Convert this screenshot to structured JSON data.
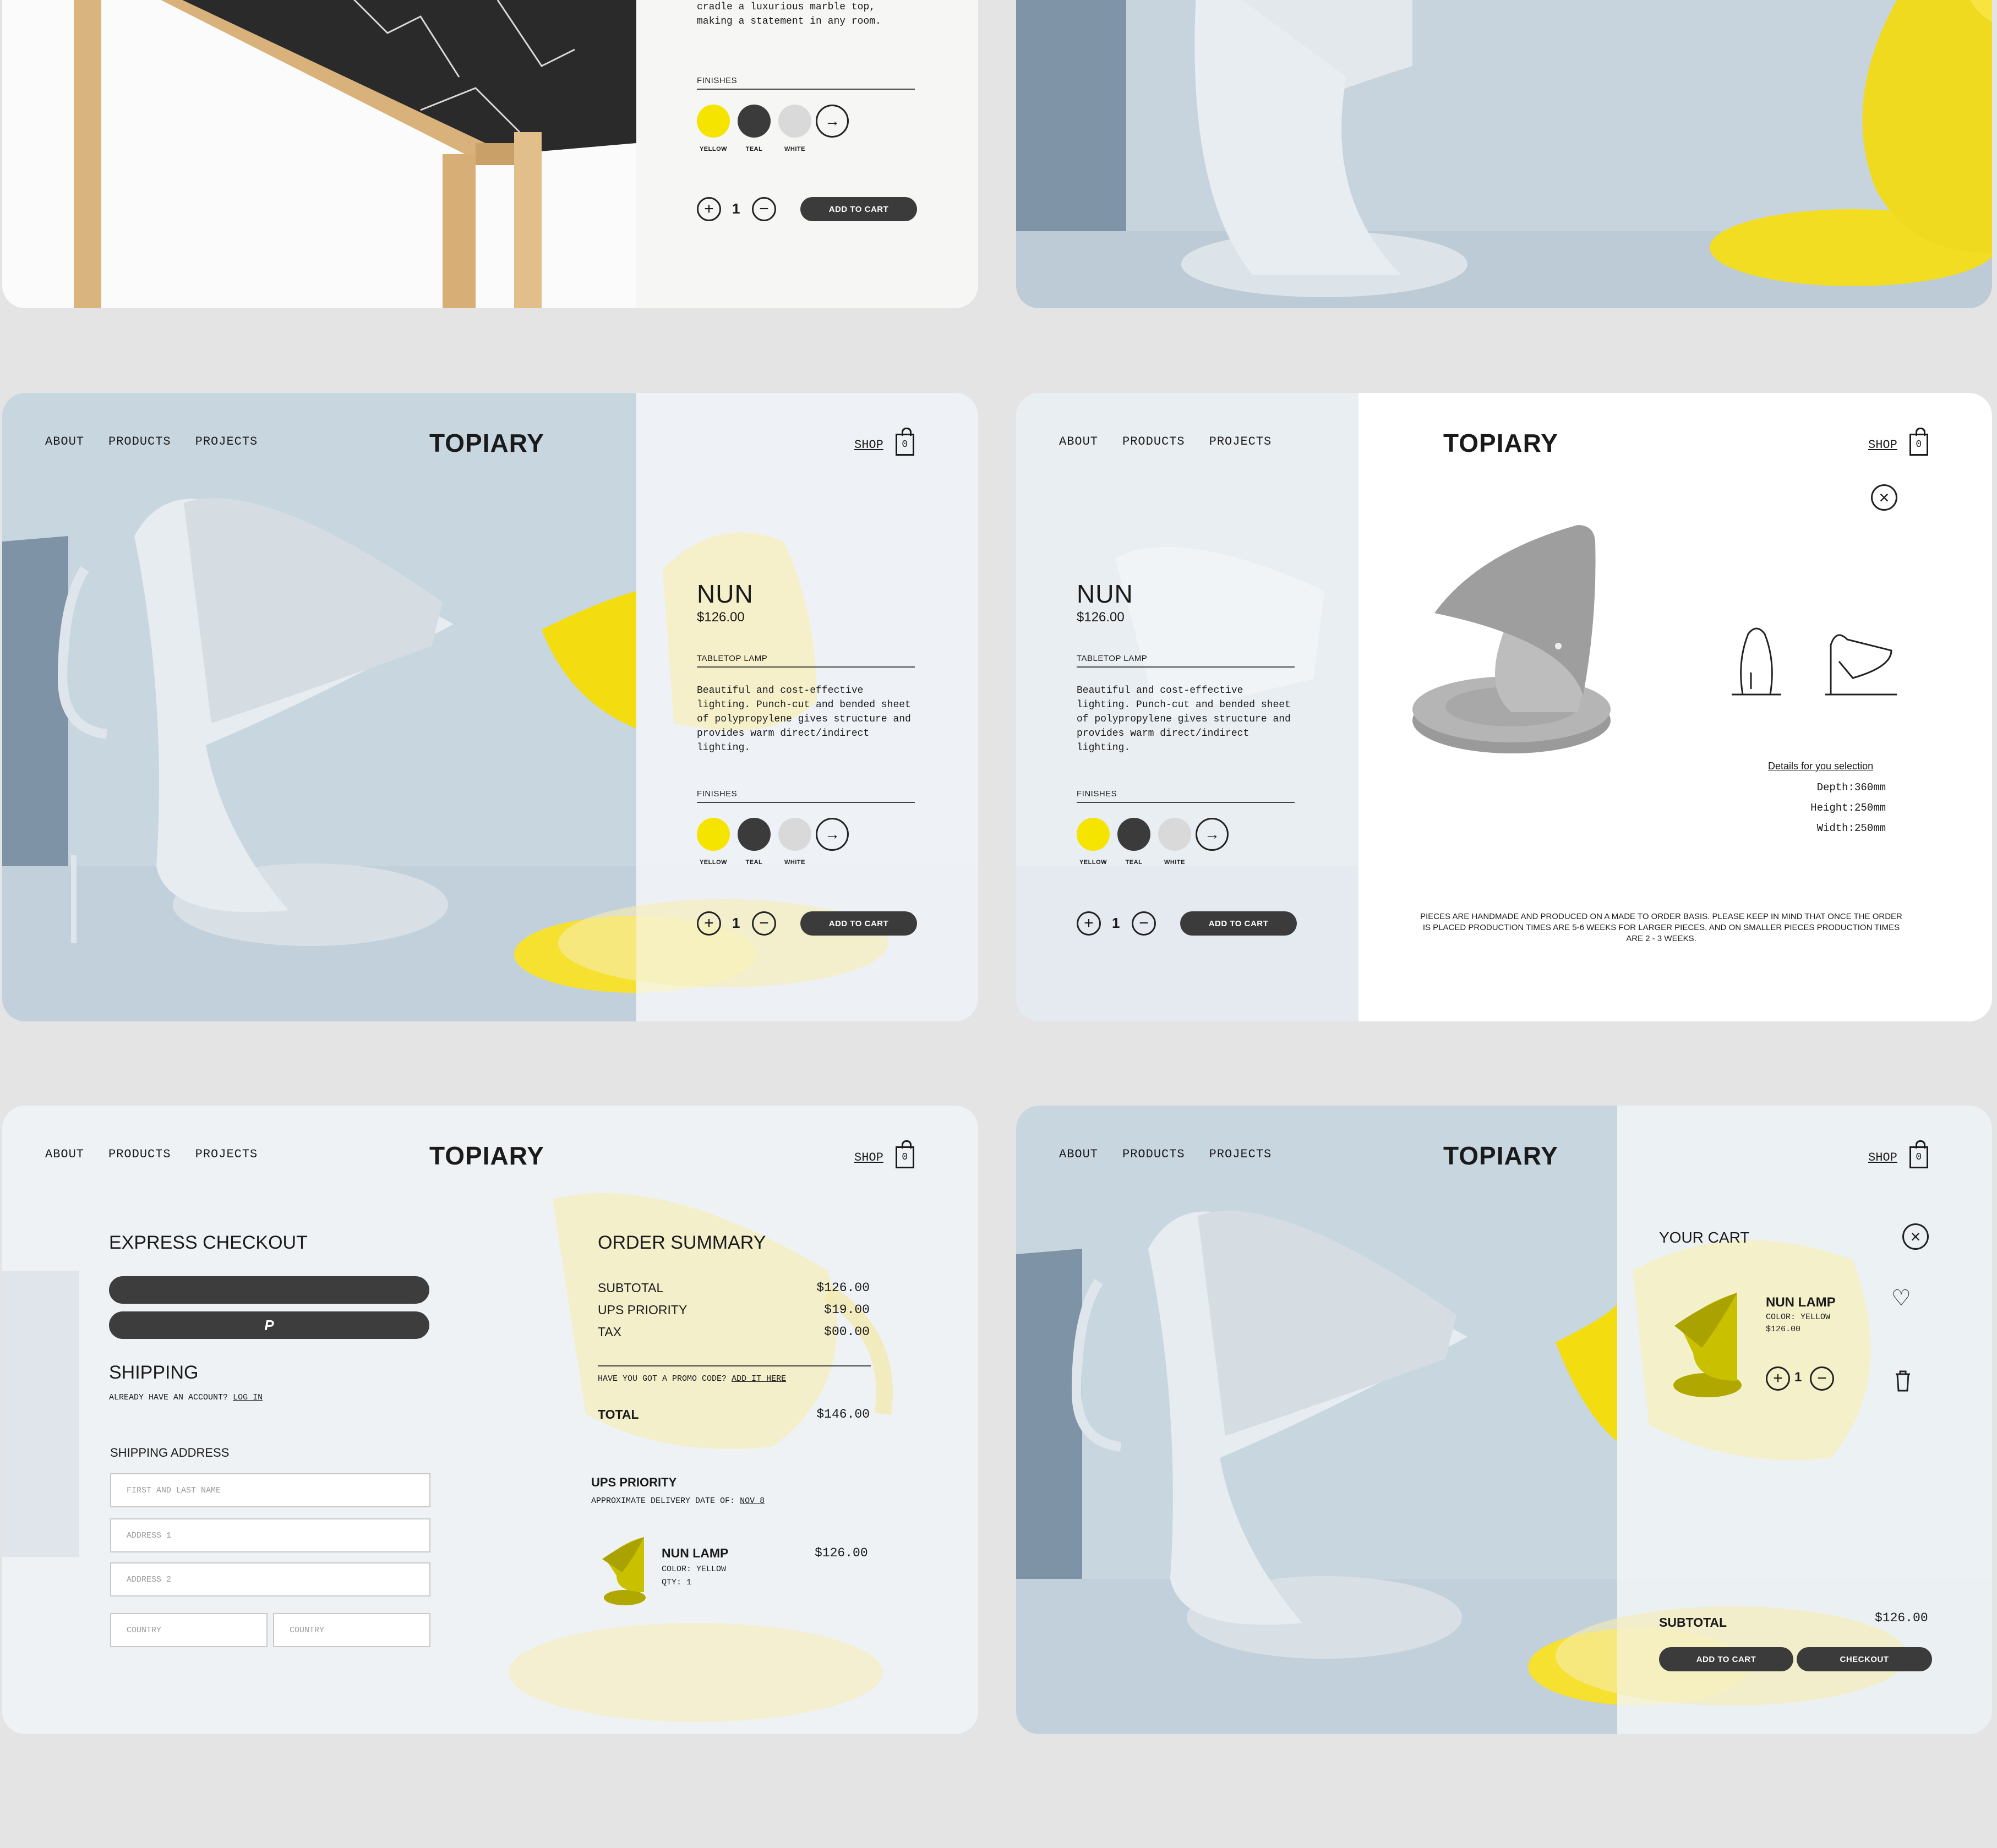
{
  "nav": {
    "about": "ABOUT",
    "products": "PRODUCTS",
    "projects": "PROJECTS",
    "logo": "TOPIARY",
    "shop": "SHOP",
    "cart_count": "0"
  },
  "table_card": {
    "desc_tail": "cradle a luxurious marble top,\nmaking a statement in any room.",
    "finishes_label": "FINISHES",
    "finishes": [
      "YELLOW",
      "TEAL",
      "WHITE"
    ],
    "qty": "1",
    "add_to_cart": "ADD TO CART"
  },
  "product": {
    "name": "NUN",
    "price": "$126.00",
    "category": "TABLETOP LAMP",
    "description": "Beautiful and cost-effective lighting. Punch-cut and bended sheet of polypropylene gives structure and provides warm direct/indirect lighting.",
    "finishes_label": "FINISHES",
    "finishes": [
      "YELLOW",
      "TEAL",
      "WHITE"
    ],
    "finish_colors": [
      "#f5e400",
      "#3b3b3b",
      "#d9d9d9"
    ],
    "qty": "1",
    "add_to_cart": "ADD TO CART"
  },
  "details": {
    "link": "Details for you selection",
    "depth": "Depth:360mm",
    "height": "Height:250mm",
    "width": "Width:250mm",
    "note": "PIECES ARE HANDMADE AND PRODUCED ON A MADE TO ORDER BASIS. PLEASE KEEP IN MIND THAT ONCE THE ORDER IS PLACED PRODUCTION TIMES ARE 5-6 WEEKS FOR LARGER PIECES, AND ON SMALLER PIECES PRODUCTION TIMES ARE 2 - 3 WEEKS."
  },
  "checkout": {
    "express_title": "EXPRESS CHECKOUT",
    "apple_pay": "",
    "paypal": "P",
    "shipping_title": "SHIPPING",
    "account_prompt": "ALREADY HAVE AN ACCOUNT?",
    "login": "LOG IN",
    "address_title": "SHIPPING ADDRESS",
    "ph_name": "FIRST AND LAST NAME",
    "ph_address1": "ADDRESS 1",
    "ph_address2": "ADDRESS 2",
    "ph_country1": "COUNTRY",
    "ph_country2": "COUNTRY"
  },
  "summary": {
    "title": "ORDER SUMMARY",
    "subtotal_label": "SUBTOTAL",
    "subtotal": "$126.00",
    "shipping_label": "UPS PRIORITY",
    "shipping": "$19.00",
    "tax_label": "TAX",
    "tax": "$00.00",
    "promo_prompt": "HAVE YOU GOT A PROMO CODE?",
    "promo_link": "ADD IT HERE",
    "total_label": "TOTAL",
    "total": "$146.00",
    "delivery_title": "UPS PRIORITY",
    "delivery_prompt": "APPROXIMATE DELIVERY DATE OF:",
    "delivery_date": "NOV 8",
    "item_name": "NUN LAMP",
    "item_color": "COLOR: YELLOW",
    "item_qty": "QTY: 1",
    "item_price": "$126.00"
  },
  "cart": {
    "title": "YOUR CART",
    "item_name": "NUN LAMP",
    "item_color": "COLOR: YELLOW",
    "item_price": "$126.00",
    "qty": "1",
    "subtotal_label": "SUBTOTAL",
    "subtotal": "$126.00",
    "add_to_cart": "ADD TO CART",
    "checkout": "CHECKOUT"
  },
  "icons": [
    "apple-icon",
    "paypal-icon",
    "bag-icon",
    "close-icon",
    "heart-icon",
    "trash-icon",
    "arrow-right-icon",
    "plus-icon",
    "minus-icon"
  ],
  "colors": {
    "accent_yellow": "#f5e400",
    "dark": "#3b3b3b",
    "bg": "#e4e4e4",
    "scene_blue": "#c9d6e0"
  }
}
